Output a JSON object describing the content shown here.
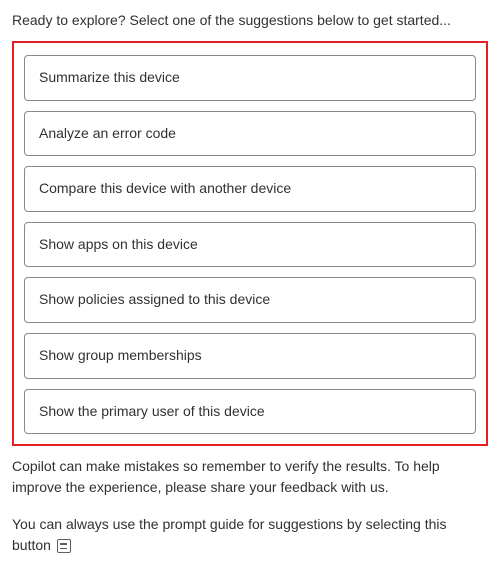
{
  "intro": "Ready to explore? Select one of the suggestions below to get started...",
  "suggestions": {
    "items": [
      "Summarize this device",
      "Analyze an error code",
      "Compare this device with another device",
      "Show apps on this device",
      "Show policies assigned to this device",
      "Show group memberships",
      "Show the primary user of this device"
    ]
  },
  "disclaimer": "Copilot can make mistakes so remember to verify the results. To help improve the experience, please share your feedback with us.",
  "prompt_guide_text": "You can always use the prompt guide for suggestions by selecting this button"
}
